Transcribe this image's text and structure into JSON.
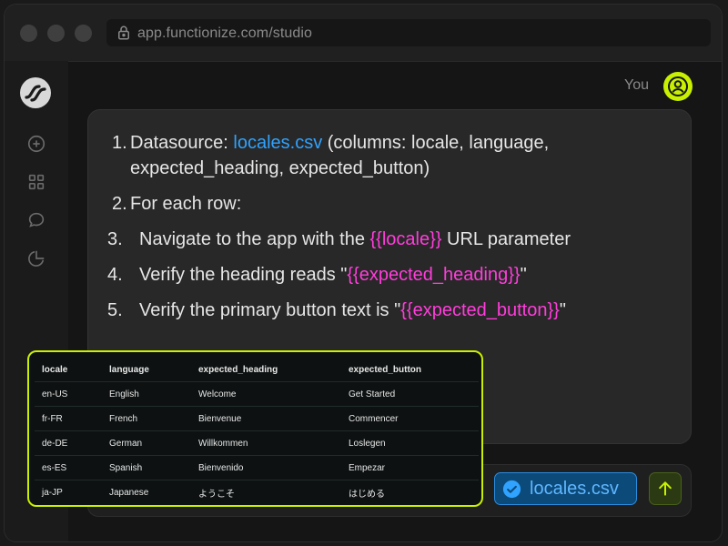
{
  "browser": {
    "url": "app.functionize.com/studio"
  },
  "chat": {
    "user_label": "You",
    "steps": [
      {
        "num": "1.",
        "line1_prefix": "Datasource: ",
        "line1_link": "locales.csv",
        "line1_suffix": " (columns: locale, language,",
        "line2": "expected_heading, expected_button)"
      },
      {
        "num": "2.",
        "text": "For each row:"
      },
      {
        "num": "3.",
        "prefix": "Navigate to the app with the ",
        "var": "{{locale}}",
        "suffix": " URL parameter"
      },
      {
        "num": "4.",
        "prefix": "Verify the heading reads \"",
        "var": "{{expected_heading}}",
        "suffix": "\""
      },
      {
        "num": "5.",
        "prefix": "Verify the primary button text is \"",
        "var": "{{expected_button}}",
        "suffix": "\""
      }
    ]
  },
  "composer": {
    "attachment_label": "locales.csv"
  },
  "preview": {
    "headers": [
      "locale",
      "language",
      "expected_heading",
      "expected_button"
    ],
    "rows": [
      [
        "en-US",
        "English",
        "Welcome",
        "Get Started"
      ],
      [
        "fr-FR",
        "French",
        "Bienvenue",
        "Commencer"
      ],
      [
        "de-DE",
        "German",
        "Willkommen",
        "Loslegen"
      ],
      [
        "es-ES",
        "Spanish",
        "Bienvenido",
        "Empezar"
      ],
      [
        "ja-JP",
        "Japanese",
        "ようこそ",
        "はじめる"
      ]
    ]
  },
  "colors": {
    "accent": "#c8f000",
    "link": "#2fa3ff",
    "variable": "#ff3ddb"
  }
}
